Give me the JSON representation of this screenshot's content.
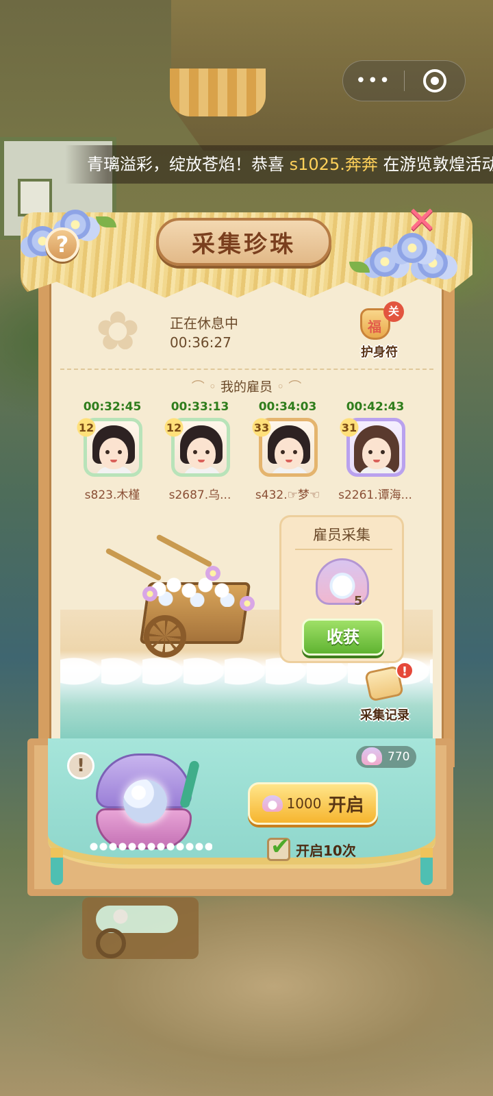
{
  "system": {
    "menu_dots": "•••"
  },
  "marquee": {
    "prefix": "青璃溢彩，绽放苍焰！恭喜 ",
    "highlight": "s1025.奔奔",
    "suffix": " 在游览敦煌活动"
  },
  "panel": {
    "title": "采集珍珠",
    "help_label": "?",
    "close_label": "✕"
  },
  "status": {
    "label": "正在休息中",
    "timer": "00:36:27"
  },
  "amulet": {
    "label": "护身符",
    "badge": "关"
  },
  "employees": {
    "section_title": "我的雇员",
    "items": [
      {
        "timer": "00:32:45",
        "level": "12",
        "name": "s823.木槿"
      },
      {
        "timer": "00:33:13",
        "level": "12",
        "name": "s2687.乌..."
      },
      {
        "timer": "00:34:03",
        "level": "33",
        "name": "s432.☞梦☜"
      },
      {
        "timer": "00:42:43",
        "level": "31",
        "name": "s2261.谭海..."
      }
    ]
  },
  "harvest": {
    "title": "雇员采集",
    "count": "5",
    "button": "收获"
  },
  "records": {
    "label": "采集记录",
    "badge": "!"
  },
  "open_panel": {
    "warn": "!",
    "pearl_balance": "770",
    "cost": "1000",
    "open_label": "开启",
    "open_ten_label": "开启10次",
    "open_ten_checked": true
  }
}
